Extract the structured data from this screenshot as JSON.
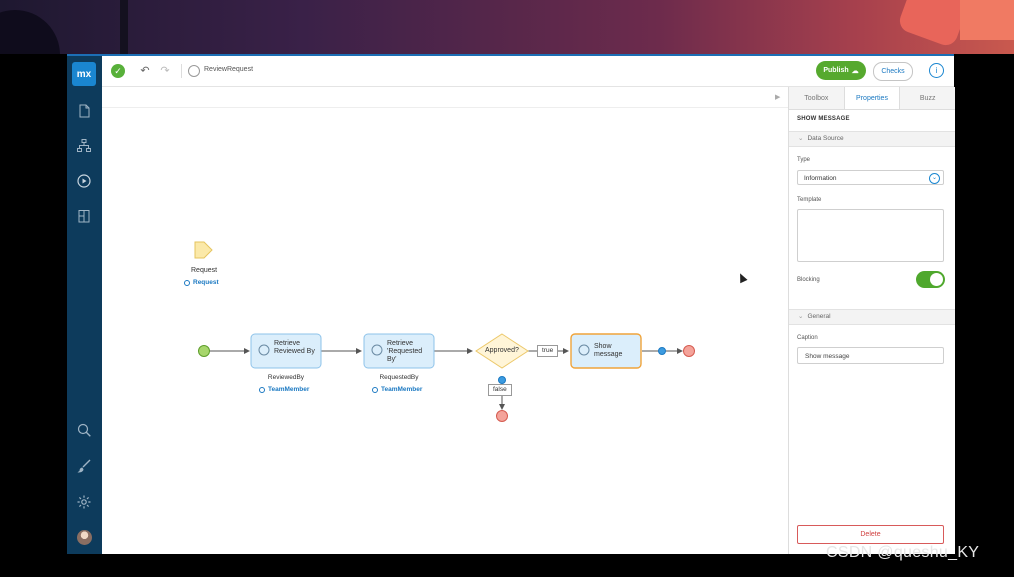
{
  "app": {
    "logo": "mx",
    "document_name": "ReviewRequest",
    "publish_label": "Publish",
    "checks_label": "Checks",
    "info_icon": "info-icon"
  },
  "sidebar": {
    "items": [
      {
        "name": "sidebar-item-pages",
        "icon": "page-icon"
      },
      {
        "name": "sidebar-item-domain-model",
        "icon": "hierarchy-icon"
      },
      {
        "name": "sidebar-item-microflows",
        "icon": "play-circle-icon"
      },
      {
        "name": "sidebar-item-resources",
        "icon": "clipboard-icon"
      },
      {
        "name": "sidebar-item-search",
        "icon": "search-icon"
      },
      {
        "name": "sidebar-item-theme",
        "icon": "brush-icon"
      },
      {
        "name": "sidebar-item-settings",
        "icon": "gear-icon"
      }
    ]
  },
  "flow": {
    "parameter": {
      "label": "Request",
      "entity": "Request"
    },
    "retrieve1": {
      "title": "Retrieve Reviewed By",
      "variable": "ReviewedBy",
      "entity": "TeamMember"
    },
    "retrieve2": {
      "title": "Retrieve 'Requested By'",
      "variable": "RequestedBy",
      "entity": "TeamMember"
    },
    "decision": {
      "label": "Approved?",
      "true_label": "true",
      "false_label": "false"
    },
    "show_message": {
      "title": "Show message"
    }
  },
  "panel": {
    "tabs": [
      "Toolbox",
      "Properties",
      "Buzz"
    ],
    "active_tab": "Properties",
    "title": "SHOW MESSAGE",
    "data_source_section": "Data Source",
    "type_label": "Type",
    "type_value": "Information",
    "template_label": "Template",
    "blocking_label": "Blocking",
    "blocking_on": true,
    "general_section": "General",
    "caption_label": "Caption",
    "caption_value": "Show message",
    "delete_label": "Delete"
  },
  "colors": {
    "brand": "#1a86d0",
    "sidebar": "#0d3b5c",
    "success": "#56a92e",
    "danger": "#d0403f",
    "activity_fill": "#dbeefb",
    "selected_border": "#f0a43a"
  },
  "watermark": "CSDN @queshu_KY"
}
